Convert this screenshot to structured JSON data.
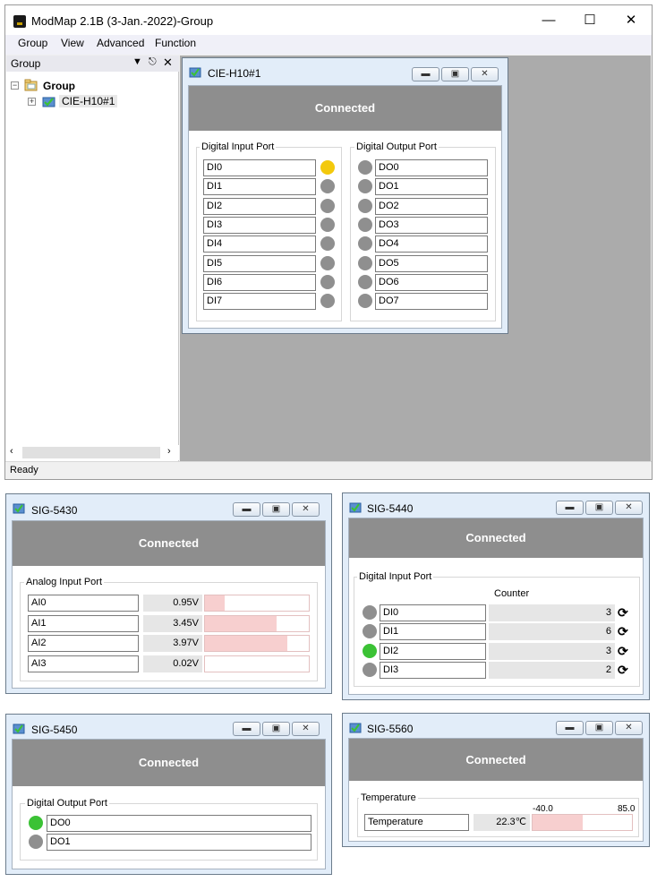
{
  "main": {
    "title": "ModMap 2.1B (3-Jan.-2022)-Group",
    "menu": [
      "Group",
      "View",
      "Advanced",
      "Function"
    ],
    "tree": {
      "header": "Group",
      "root": "Group",
      "device": "CIE-H10#1"
    },
    "status": "Ready"
  },
  "win_cie": {
    "title": "CIE-H10#1",
    "status": "Connected",
    "di_label": "Digital Input Port",
    "do_label": "Digital Output Port",
    "di": [
      {
        "name": "DI0",
        "state": "on"
      },
      {
        "name": "DI1",
        "state": "off"
      },
      {
        "name": "DI2",
        "state": "off"
      },
      {
        "name": "DI3",
        "state": "off"
      },
      {
        "name": "DI4",
        "state": "off"
      },
      {
        "name": "DI5",
        "state": "off"
      },
      {
        "name": "DI6",
        "state": "off"
      },
      {
        "name": "DI7",
        "state": "off"
      }
    ],
    "do": [
      "DO0",
      "DO1",
      "DO2",
      "DO3",
      "DO4",
      "DO5",
      "DO6",
      "DO7"
    ]
  },
  "win_5430": {
    "title": "SIG-5430",
    "status": "Connected",
    "ai_label": "Analog Input Port",
    "ai": [
      {
        "name": "AI0",
        "value": "0.95V",
        "fill": 0.19
      },
      {
        "name": "AI1",
        "value": "3.45V",
        "fill": 0.69
      },
      {
        "name": "AI2",
        "value": "3.97V",
        "fill": 0.79
      },
      {
        "name": "AI3",
        "value": "0.02V",
        "fill": 0.0
      }
    ]
  },
  "win_5440": {
    "title": "SIG-5440",
    "status": "Connected",
    "di_label": "Digital Input Port",
    "counter_label": "Counter",
    "di": [
      {
        "name": "DI0",
        "count": "3",
        "state": "off"
      },
      {
        "name": "DI1",
        "count": "6",
        "state": "off"
      },
      {
        "name": "DI2",
        "count": "3",
        "state": "on"
      },
      {
        "name": "DI3",
        "count": "2",
        "state": "off"
      }
    ]
  },
  "win_5450": {
    "title": "SIG-5450",
    "status": "Connected",
    "do_label": "Digital Output Port",
    "do": [
      {
        "name": "DO0",
        "state": "on"
      },
      {
        "name": "DO1",
        "state": "off"
      }
    ]
  },
  "win_5560": {
    "title": "SIG-5560",
    "status": "Connected",
    "temp_group": "Temperature",
    "temp_name": "Temperature",
    "temp_value": "22.3℃",
    "min": "-40.0",
    "max": "85.0",
    "fill": 0.5
  },
  "colors": {
    "connected_bg": "#8e8e8e",
    "led_off": "#8f8f8f",
    "led_yellow": "#f3c90c",
    "led_green": "#3bc235",
    "bar_fill": "#f7cfcf",
    "mdi_bg": "#ababab"
  },
  "icons": [
    "app-icon",
    "folder-icon",
    "device-check-icon",
    "minimize-icon",
    "maximize-icon",
    "close-icon",
    "refresh-icon"
  ]
}
